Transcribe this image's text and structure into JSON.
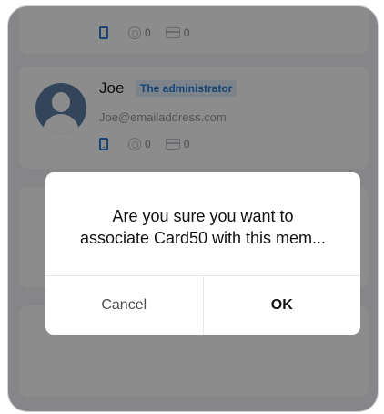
{
  "members": [
    {
      "phone_credential": "phone-icon",
      "fingerprint_count": "0",
      "card_count": "0"
    },
    {
      "name": "Joe",
      "role": "The administrator",
      "email": "Joe@emailaddress.com",
      "phone_credential": "phone-icon",
      "fingerprint_count": "0",
      "card_count": "0"
    }
  ],
  "dialog": {
    "message": "Are you sure you want to\nassociate Card50 with this mem...",
    "cancel_label": "Cancel",
    "ok_label": "OK"
  },
  "colors": {
    "accent": "#2b7cd3",
    "overlay": "rgba(0,0,0,0.45)",
    "dialog_bg": "#ffffff"
  }
}
